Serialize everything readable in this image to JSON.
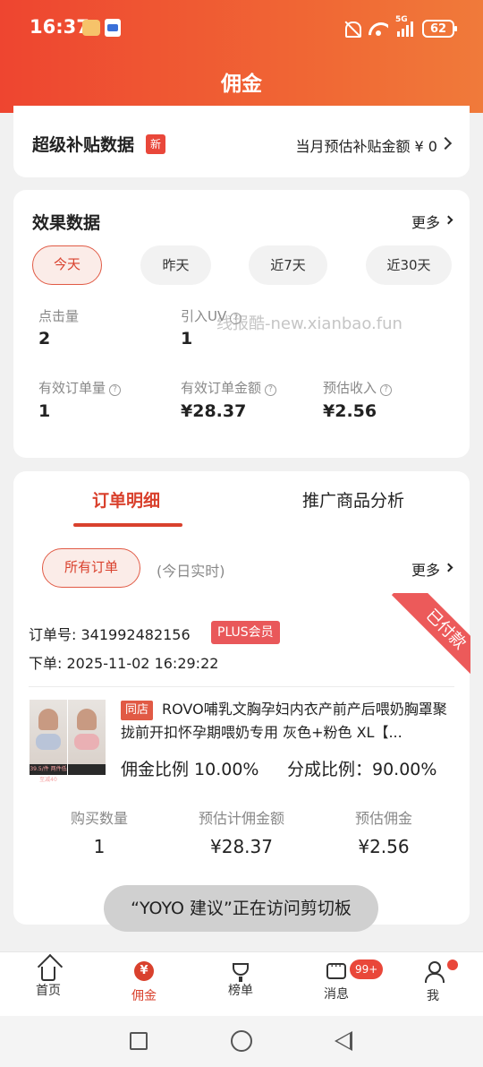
{
  "status_bar": {
    "time": "16:37",
    "network": "5G",
    "battery": "62"
  },
  "header": {
    "title": "佣金"
  },
  "subsidy": {
    "title": "超级补贴数据",
    "badge": "新",
    "amount_text": "当月预估补贴金额 ¥ 0"
  },
  "effect": {
    "title": "效果数据",
    "more": "更多",
    "tabs": [
      "今天",
      "昨天",
      "近7天",
      "近30天"
    ],
    "active_tab": "今天",
    "metrics": [
      {
        "label": "点击量",
        "value": "2"
      },
      {
        "label": "引入UV",
        "value": "1"
      },
      {
        "label": "有效订单量",
        "value": "1"
      },
      {
        "label": "有效订单金额",
        "value": "¥28.37"
      },
      {
        "label": "预估收入",
        "value": "¥2.56"
      }
    ],
    "watermark": "线报酷-new.xianbao.fun"
  },
  "orders": {
    "tabs": [
      "订单明细",
      "推广商品分析"
    ],
    "active_tab": "订单明细",
    "filter_button": "所有订单",
    "filter_note": "(今日实时)",
    "more": "更多",
    "status_ribbon": "已付款",
    "order_no_label": "订单号:",
    "order_no": "341992482156",
    "member_badge": "PLUS会员",
    "order_time_label": "下单:",
    "order_time": "2025-11-02 16:29:22",
    "product": {
      "shop_tag": "同店",
      "title": "ROVO哺乳文胸孕妇内衣产前产后喂奶胸罩聚拢前开扣怀孕期喂奶专用 灰色+粉色 XL【...",
      "thumb_caption": "39.5/件 两件低至减40",
      "commission_rate_text": "佣金比例 10.00%",
      "share_rate_text": "分成比例：90.00%"
    },
    "stats": [
      {
        "label": "购买数量",
        "value": "1"
      },
      {
        "label": "预估计佣金额",
        "value": "¥28.37"
      },
      {
        "label": "预估佣金",
        "value": "¥2.56"
      }
    ]
  },
  "toast": "“YOYO 建议”正在访问剪切板",
  "bottom_nav": {
    "items": [
      {
        "label": "首页",
        "icon": "home-icon"
      },
      {
        "label": "佣金",
        "icon": "commission-yen-icon"
      },
      {
        "label": "榜单",
        "icon": "trophy-icon"
      },
      {
        "label": "消息",
        "icon": "message-icon"
      },
      {
        "label": "我",
        "icon": "user-icon"
      }
    ],
    "active": "佣金",
    "message_badge": "99+"
  },
  "colors": {
    "accent": "#d9412d",
    "header_start": "#ee4530",
    "header_end": "#f07a3a"
  }
}
